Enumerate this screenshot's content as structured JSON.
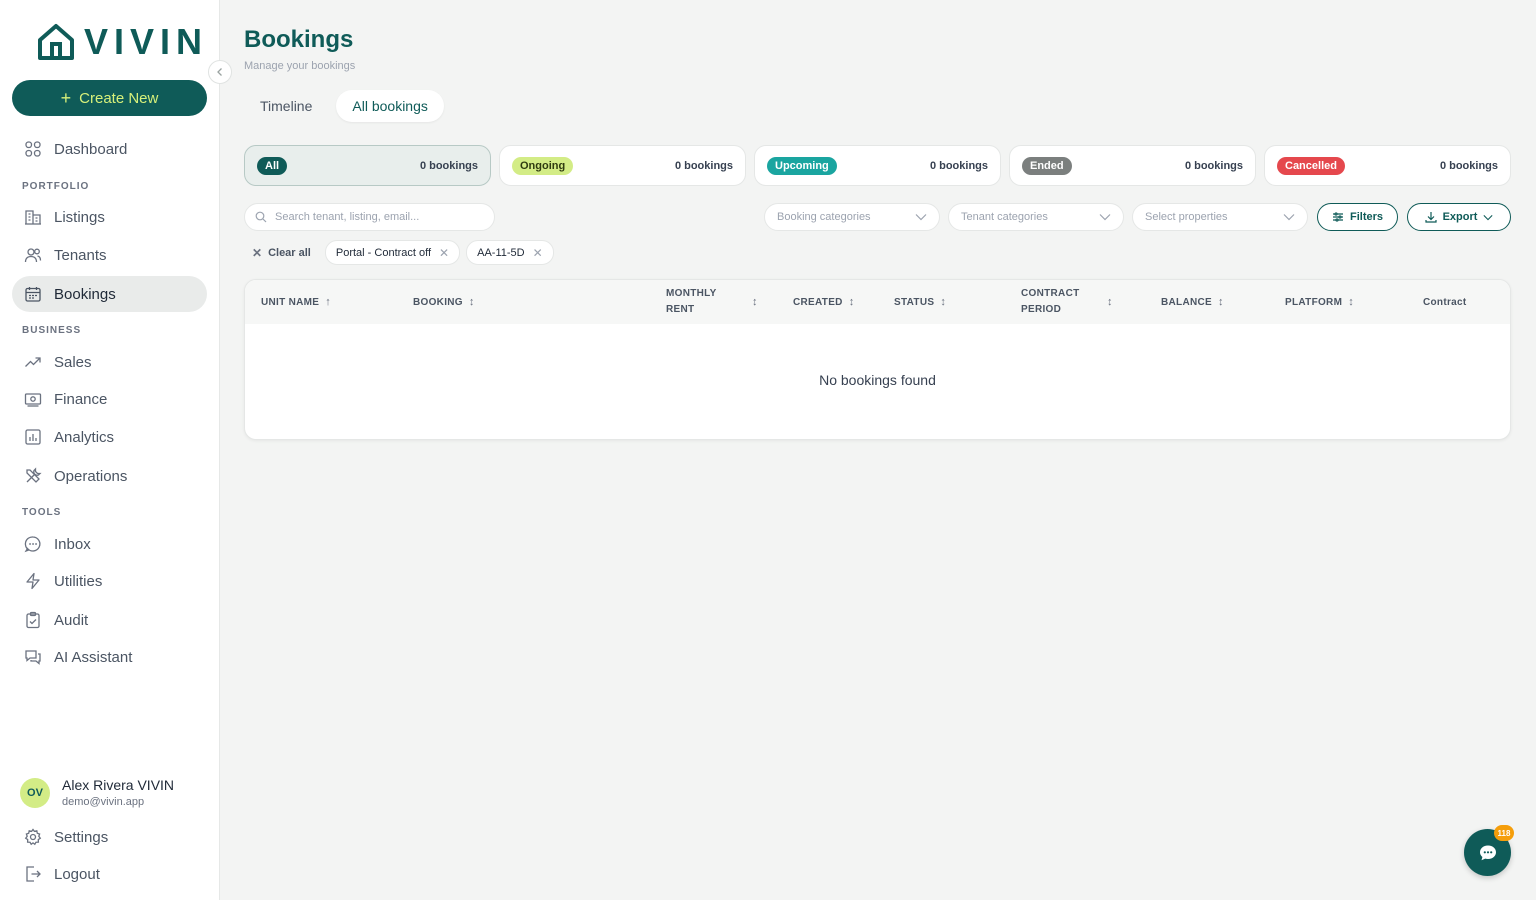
{
  "brand": {
    "name": "VIVIN",
    "primary": "#0f5b58",
    "accent": "#d7f07a"
  },
  "sidebar": {
    "create_label": "Create New",
    "collapse_icon": "chevron-left-icon",
    "dashboard": "Dashboard",
    "sections": {
      "portfolio": "PORTFOLIO",
      "business": "BUSINESS",
      "tools": "TOOLS"
    },
    "items": {
      "listings": "Listings",
      "tenants": "Tenants",
      "bookings": "Bookings",
      "sales": "Sales",
      "finance": "Finance",
      "analytics": "Analytics",
      "operations": "Operations",
      "inbox": "Inbox",
      "utilities": "Utilities",
      "audit": "Audit",
      "ai_assistant": "AI Assistant"
    },
    "user": {
      "initials": "OV",
      "name": "Alex Rivera VIVIN",
      "email": "demo@vivin.app"
    },
    "settings": "Settings",
    "logout": "Logout"
  },
  "header": {
    "title": "Bookings",
    "subtitle": "Manage your bookings"
  },
  "tabs": {
    "timeline": "Timeline",
    "all": "All bookings"
  },
  "status_cards": [
    {
      "label": "All",
      "count": "0 bookings",
      "bg": "#0f5b58",
      "fg": "#ffffff"
    },
    {
      "label": "Ongoing",
      "count": "0 bookings",
      "bg": "#d3ec86",
      "fg": "#2f3b10"
    },
    {
      "label": "Upcoming",
      "count": "0 bookings",
      "bg": "#1aa5a0",
      "fg": "#ffffff"
    },
    {
      "label": "Ended",
      "count": "0 bookings",
      "bg": "#7b7f7e",
      "fg": "#ffffff"
    },
    {
      "label": "Cancelled",
      "count": "0 bookings",
      "bg": "#e5484d",
      "fg": "#ffffff"
    }
  ],
  "search": {
    "placeholder": "Search tenant, listing, email..."
  },
  "filters": {
    "booking_categories": "Booking categories",
    "tenant_categories": "Tenant categories",
    "select_properties": "Select properties",
    "filters_label": "Filters",
    "export_label": "Export"
  },
  "chips": {
    "clear_all": "Clear all",
    "items": [
      "Portal - Contract off",
      "AA-11-5D"
    ]
  },
  "table": {
    "columns": {
      "unit_name": "UNIT NAME",
      "booking": "BOOKING",
      "monthly_rent": "MONTHLY RENT",
      "created": "CREATED",
      "status": "STATUS",
      "contract_period": "CONTRACT PERIOD",
      "balance": "BALANCE",
      "platform": "PLATFORM",
      "contract": "Contract"
    },
    "empty": "No bookings found"
  },
  "chat": {
    "badge": "118"
  }
}
